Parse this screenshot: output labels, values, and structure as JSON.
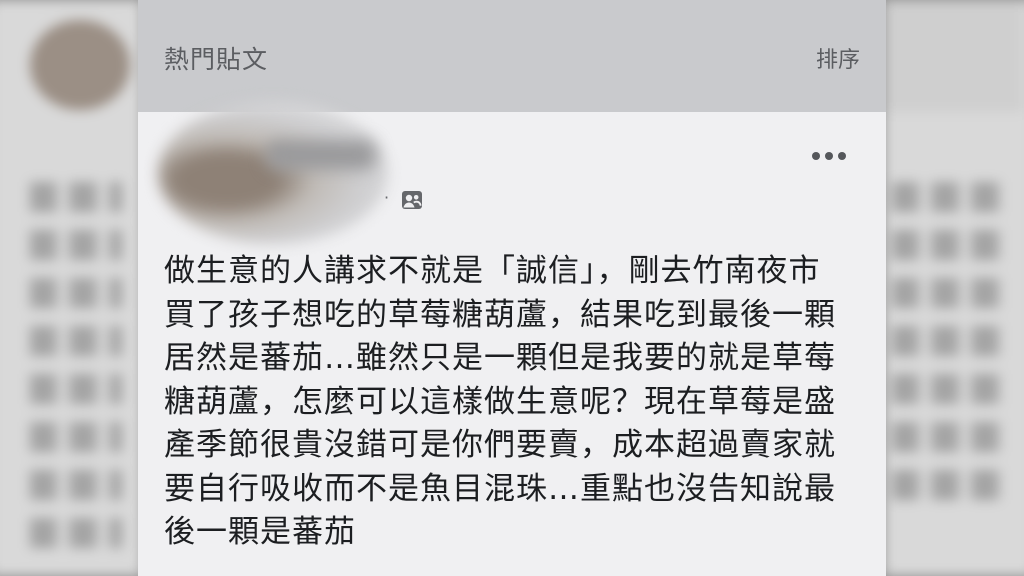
{
  "feed": {
    "header_title": "熱門貼文",
    "sort_label": "排序"
  },
  "post": {
    "meta_separator": "·",
    "text": "做生意的人講求不就是「誠信」，剛去竹南夜市\n買了孩子想吃的草莓糖葫蘆，結果吃到最後一顆\n居然是蕃茄…雖然只是一顆但是我要的就是草莓\n糖葫蘆，怎麼可以這樣做生意呢？現在草莓是盛\n產季節很貴沒錯可是你們要賣，成本超過賣家就\n要自行吸收而不是魚目混珠…重點也沒告知說最\n後一顆是蕃茄"
  },
  "icons": {
    "more": "more-options-icon",
    "audience": "group-audience-icon"
  },
  "colors": {
    "header_bg": "#c9cacd",
    "panel_bg": "#f0f0f2",
    "text": "#1c1e21",
    "muted": "#5b5d61"
  }
}
